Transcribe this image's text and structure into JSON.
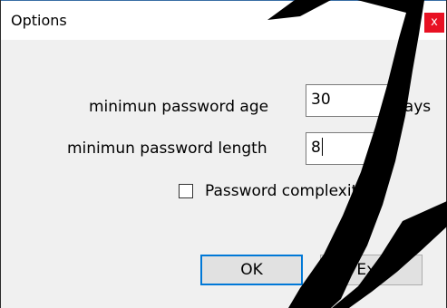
{
  "window": {
    "title": "Options",
    "close_glyph": "x"
  },
  "form": {
    "min_age_label": "minimun password age",
    "min_age_value": "30",
    "min_age_unit": "days",
    "min_length_label": "minimun password length",
    "min_length_value": "8",
    "complexity_label": "Password complexity",
    "complexity_checked": false
  },
  "buttons": {
    "ok_label": "OK",
    "exit_label": "Exit"
  },
  "colors": {
    "close_red": "#e81123",
    "focus_blue": "#0078d7",
    "dialog_bg": "#f0f0f0",
    "watermark": "#000000"
  }
}
